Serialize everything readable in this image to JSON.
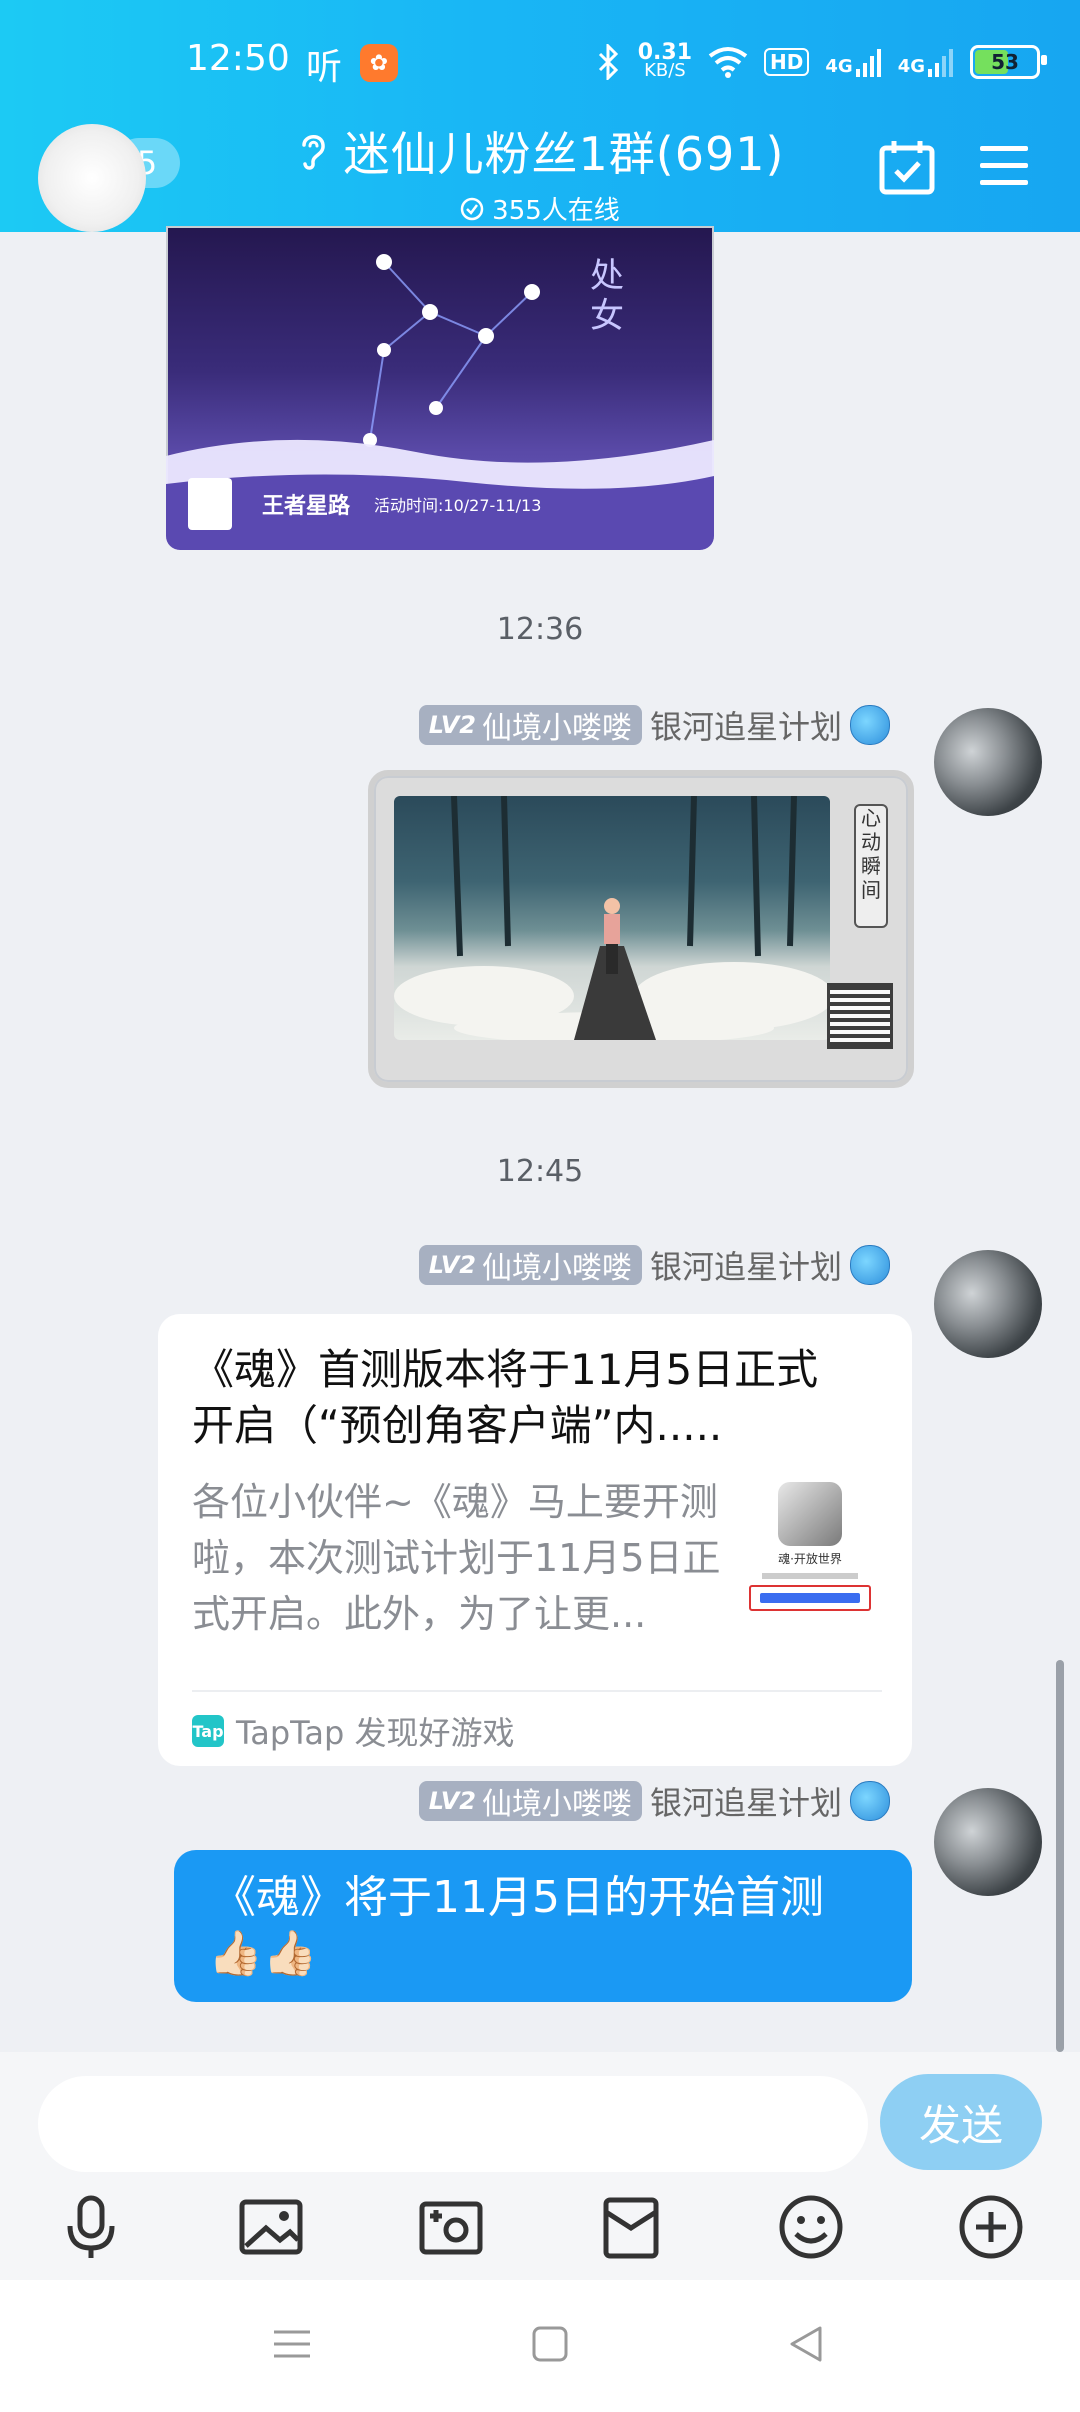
{
  "status_bar": {
    "time": "12:50",
    "ting": "听",
    "speed_value": "0.31",
    "speed_unit": "KB/S",
    "hd": "HD",
    "net1": "4G",
    "net2": "4G",
    "battery": "53"
  },
  "header": {
    "back_count": "5",
    "title": "迷仙儿粉丝1群(691)",
    "online": "355人在线"
  },
  "messages": {
    "time1": "12:36",
    "time2": "12:45",
    "sender": {
      "level": "LV2",
      "nickname": "仙境小喽喽",
      "title": "银河追星计划"
    },
    "top_image": {
      "caption_main": "王者星路",
      "caption_sub": "活动时间:10/27-11/13",
      "vertical_text": "处女"
    },
    "game_image": {
      "side_text": "心动瞬间"
    },
    "link_card": {
      "title_line1": "《魂》首测版本将于11月5日正式",
      "title_line2": "开启（“预创角客户端”内.....",
      "desc_line1": "各位小伙伴~《魂》马上要开测",
      "desc_line2": "啦，本次测试计划于11月5日正",
      "desc_line3": "式开启。此外，为了让更...",
      "thumb_caption": "魂·开放世界",
      "source": "TapTap 发现好游戏",
      "source_icon": "Tap"
    },
    "text_bubble": {
      "line1": "《魂》将于11月5日的开始首测",
      "line2": "👍🏻👍🏻"
    }
  },
  "input": {
    "placeholder": "",
    "send_label": "发送"
  }
}
